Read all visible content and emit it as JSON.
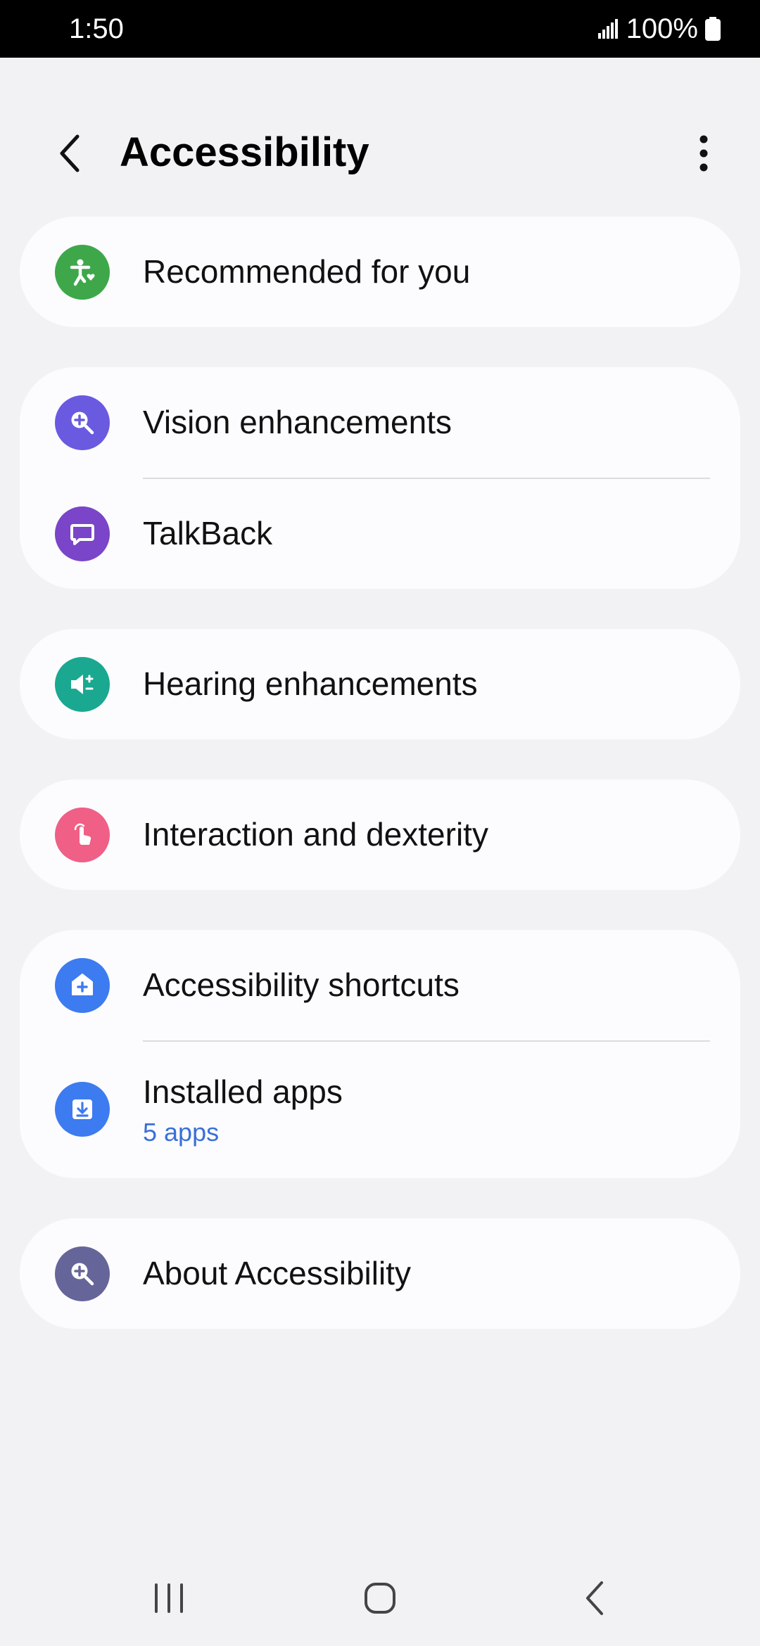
{
  "status_bar": {
    "time": "1:50",
    "battery": "100%",
    "icons": [
      "signal-icon",
      "battery-icon"
    ]
  },
  "header": {
    "title": "Accessibility",
    "back_icon": "back-chevron-icon",
    "more_icon": "more-vert-icon"
  },
  "items": {
    "recommended": {
      "label": "Recommended for you",
      "icon": "accessibility-person-heart-icon",
      "color": "#3ea74a"
    },
    "vision": {
      "label": "Vision enhancements",
      "icon": "magnify-plus-icon",
      "color": "#6a5ae0"
    },
    "talkback": {
      "label": "TalkBack",
      "icon": "speech-bubble-icon",
      "color": "#7a45c8"
    },
    "hearing": {
      "label": "Hearing enhancements",
      "icon": "speaker-plus-minus-icon",
      "color": "#1aa890"
    },
    "interaction": {
      "label": "Interaction and dexterity",
      "icon": "tap-finger-icon",
      "color": "#ef5f86"
    },
    "shortcuts": {
      "label": "Accessibility shortcuts",
      "icon": "home-plus-icon",
      "color": "#3d7bf0"
    },
    "installed": {
      "label": "Installed apps",
      "sublabel": "5 apps",
      "icon": "download-tray-icon",
      "color": "#3d7bf0"
    },
    "about": {
      "label": "About Accessibility",
      "icon": "magnify-plus-icon",
      "color": "#66659a"
    }
  },
  "nav_bar": {
    "icons": [
      "recents-icon",
      "home-icon",
      "back-icon"
    ]
  }
}
